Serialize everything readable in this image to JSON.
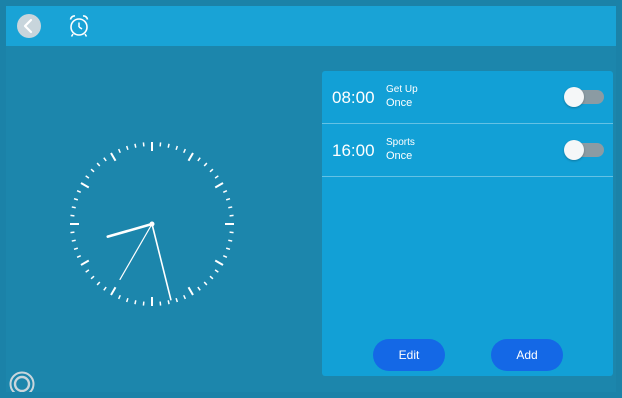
{
  "header": {
    "back_icon": "chevron-left-icon",
    "alarm_icon": "alarm-clock-icon"
  },
  "clock": {
    "hour_angle_deg": 254,
    "minute_angle_deg": 166,
    "second_angle_deg": 210
  },
  "alarms": [
    {
      "time": "08:00",
      "label": "Get Up",
      "repeat": "Once",
      "enabled": false
    },
    {
      "time": "16:00",
      "label": "Sports",
      "repeat": "Once",
      "enabled": false
    }
  ],
  "actions": {
    "edit_label": "Edit",
    "add_label": "Add"
  },
  "colors": {
    "topbar": "#19a3d6",
    "background": "#1c86ac",
    "panel": "#12a0d6",
    "button": "#1468e6",
    "toggle_off": "#8b9ba3"
  },
  "footer": {
    "home_icon": "home-ring-icon"
  }
}
